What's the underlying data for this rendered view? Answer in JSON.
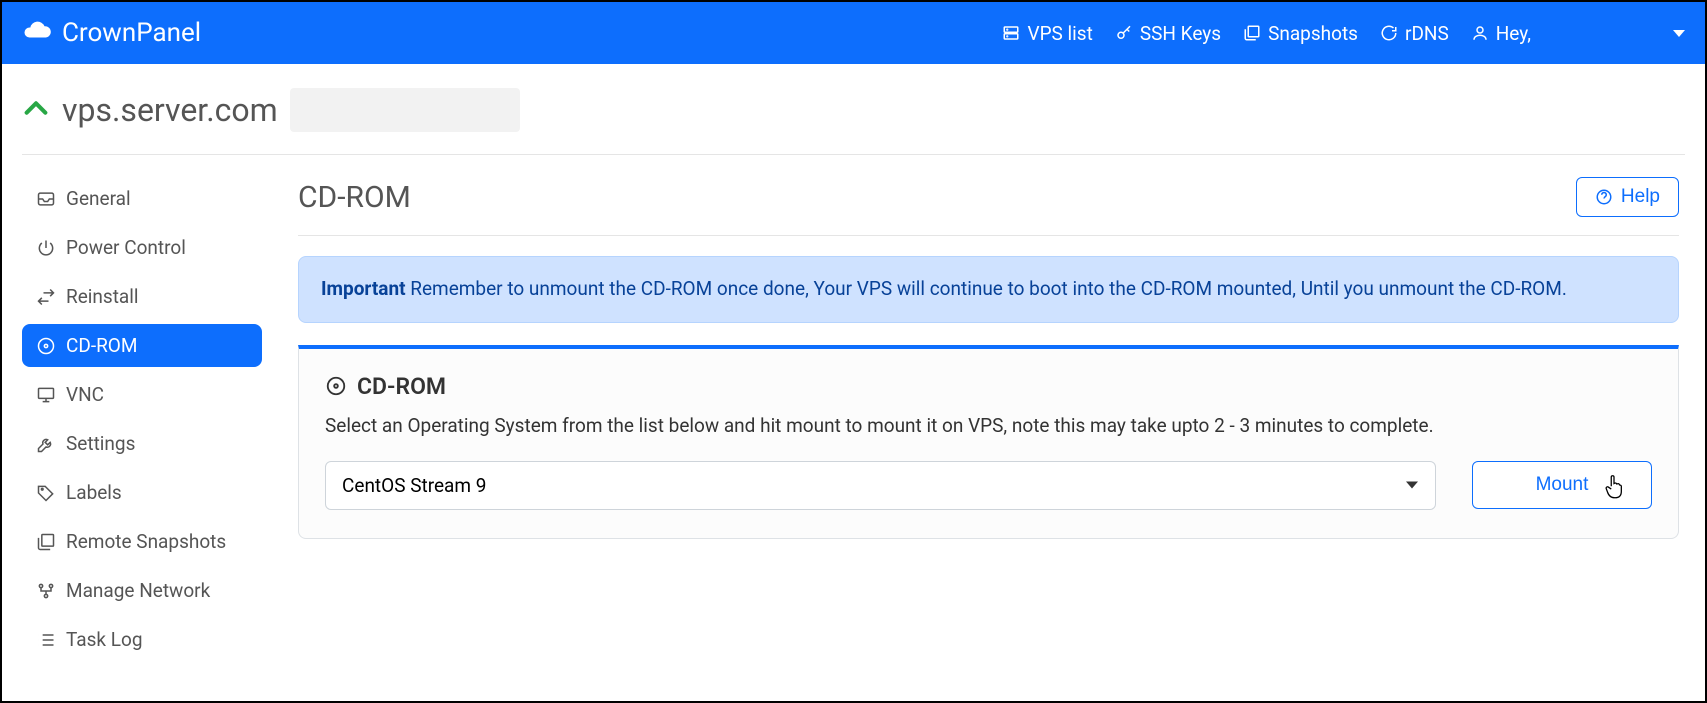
{
  "brand": {
    "name": "CrownPanel"
  },
  "topnav": {
    "vps_list": "VPS list",
    "ssh_keys": "SSH Keys",
    "snapshots": "Snapshots",
    "rdns": "rDNS",
    "greeting": "Hey,"
  },
  "header": {
    "host": "vps.server.com"
  },
  "sidebar": {
    "items": [
      {
        "label": "General"
      },
      {
        "label": "Power Control"
      },
      {
        "label": "Reinstall"
      },
      {
        "label": "CD-ROM"
      },
      {
        "label": "VNC"
      },
      {
        "label": "Settings"
      },
      {
        "label": "Labels"
      },
      {
        "label": "Remote Snapshots"
      },
      {
        "label": "Manage Network"
      },
      {
        "label": "Task Log"
      }
    ]
  },
  "main": {
    "title": "CD-ROM",
    "help_label": "Help",
    "alert_strong": "Important",
    "alert_text": " Remember to unmount the CD-ROM once done, Your VPS will continue to boot into the CD-ROM mounted, Until you unmount the CD-ROM.",
    "card_title": "CD-ROM",
    "card_desc": "Select an Operating System from the list below and hit mount to mount it on VPS, note this may take upto 2 - 3 minutes to complete.",
    "selected_os": "CentOS Stream 9",
    "mount_label": "Mount"
  }
}
